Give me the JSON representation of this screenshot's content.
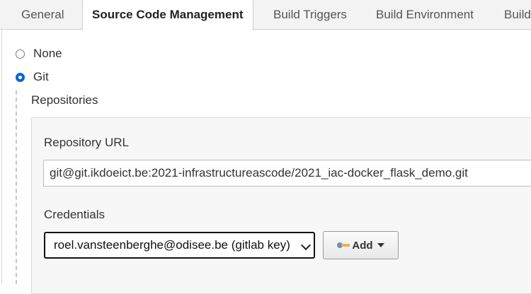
{
  "tabs": [
    {
      "label": "General",
      "active": false
    },
    {
      "label": "Source Code Management",
      "active": true
    },
    {
      "label": "Build Triggers",
      "active": false
    },
    {
      "label": "Build Environment",
      "active": false
    },
    {
      "label": "Build",
      "active": false
    }
  ],
  "scm_options": [
    {
      "label": "None",
      "checked": false
    },
    {
      "label": "Git",
      "checked": true
    }
  ],
  "repositories": {
    "title": "Repositories",
    "url_label": "Repository URL",
    "url_value": "git@git.ikdoeict.be:2021-infrastructureascode/2021_iac-docker_flask_demo.git",
    "credentials_label": "Credentials",
    "credentials_selected": "roel.vansteenberghe@odisee.be (gitlab key)",
    "add_button_label": "Add"
  },
  "colors": {
    "accent": "#0b63d6",
    "tab_bar_bg": "#f3f3f3",
    "panel_bg": "#f7f7f7"
  },
  "icons": {
    "add_button": "key-icon",
    "add_button_dropdown": "caret-down-icon",
    "select": "chevron-down-icon"
  }
}
